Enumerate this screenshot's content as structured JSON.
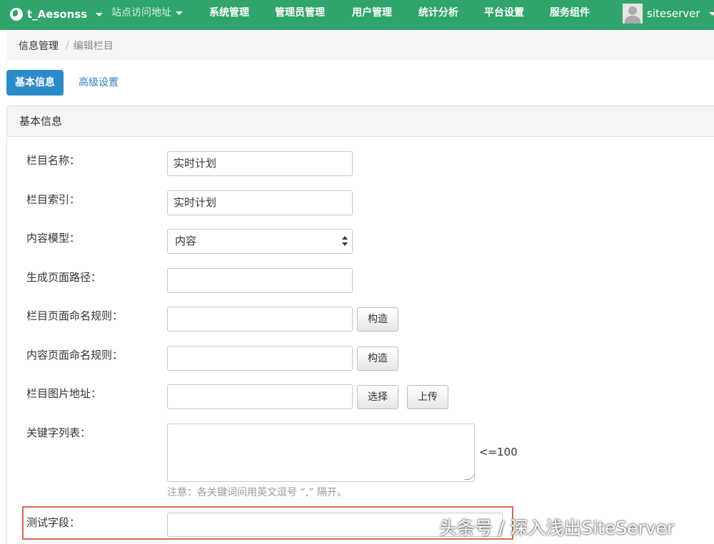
{
  "nav": {
    "site_name": "t_Aesonss",
    "items": [
      "站点访问地址",
      "系统管理",
      "管理员管理",
      "用户管理",
      "统计分析",
      "平台设置",
      "服务组件"
    ],
    "user_name": "siteserver"
  },
  "breadcrumb": {
    "root": "信息管理",
    "separator": "/",
    "current": "编辑栏目"
  },
  "tabs": {
    "basic": "基本信息",
    "advanced": "高级设置"
  },
  "panel": {
    "title": "基本信息"
  },
  "form": {
    "channel_name": {
      "label": "栏目名称：",
      "value": "实时计划"
    },
    "channel_index": {
      "label": "栏目索引：",
      "value": "实时计划"
    },
    "content_model": {
      "label": "内容模型：",
      "value": "内容"
    },
    "page_path": {
      "label": "生成页面路径：",
      "value": ""
    },
    "channel_naming_rule": {
      "label": "栏目页面命名规则：",
      "value": "",
      "button": "构造"
    },
    "content_naming_rule": {
      "label": "内容页面命名规则：",
      "value": "",
      "button": "构造"
    },
    "image_url": {
      "label": "栏目图片地址：",
      "value": "",
      "select_button": "选择",
      "upload_button": "上传"
    },
    "keywords": {
      "label": "关键字列表：",
      "value": "",
      "limit_hint": "<=100",
      "note": "注意：各关键词间用英文逗号 “,” 隔开。"
    },
    "test_field": {
      "label": "测试字段：",
      "value": ""
    }
  },
  "watermark": "头条号 / 深入浅出SiteServer",
  "colors": {
    "nav_bg": "#2fa46c",
    "tab_active": "#2c8bc9",
    "highlight_border": "#d9684a"
  }
}
